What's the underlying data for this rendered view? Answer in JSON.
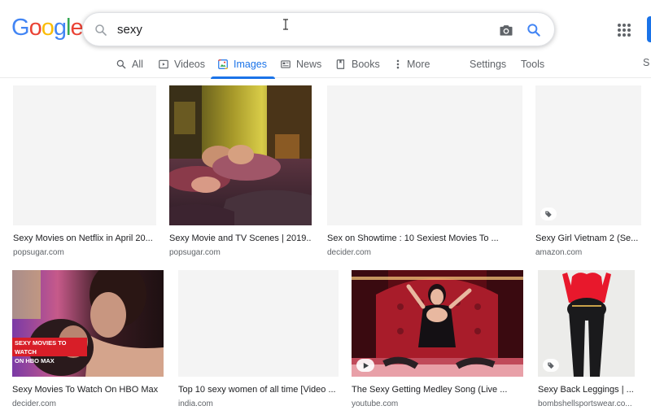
{
  "logo": {
    "letters": [
      "G",
      "o",
      "o",
      "g",
      "l",
      "e"
    ],
    "colors": [
      "#4285F4",
      "#EA4335",
      "#FBBC05",
      "#4285F4",
      "#34A853",
      "#EA4335"
    ]
  },
  "search": {
    "query": "sexy"
  },
  "tabs": {
    "all": "All",
    "videos": "Videos",
    "images": "Images",
    "news": "News",
    "books": "Books",
    "more": "More",
    "settings": "Settings",
    "tools": "Tools",
    "cut": "S"
  },
  "results": [
    {
      "title": "Sexy Movies on Netflix in April 20...",
      "source": "popsugar.com"
    },
    {
      "title": "Sexy Movie and TV Scenes | 2019...",
      "source": "popsugar.com"
    },
    {
      "title": "Sex on Showtime : 10 Sexiest Movies To ...",
      "source": "decider.com"
    },
    {
      "title": "Sexy Girl Vietnam 2 (Se...",
      "source": "amazon.com"
    },
    {
      "title": "Sexy Movies To Watch On HBO Max",
      "source": "decider.com"
    },
    {
      "title": "Top 10 sexy women of all time [Video ...",
      "source": "india.com"
    },
    {
      "title": "The Sexy Getting Medley Song (Live ...",
      "source": "youtube.com"
    },
    {
      "title": "Sexy Back Leggings | ...",
      "source": "bombshellsportswear.co..."
    }
  ],
  "thumb_overlay": {
    "line1": "SEXY MOVIES TO WATCH",
    "line2": "ON HBO MAX"
  },
  "colors": {
    "accent": "#1a73e8",
    "placeholder": "#f4f4f4"
  }
}
